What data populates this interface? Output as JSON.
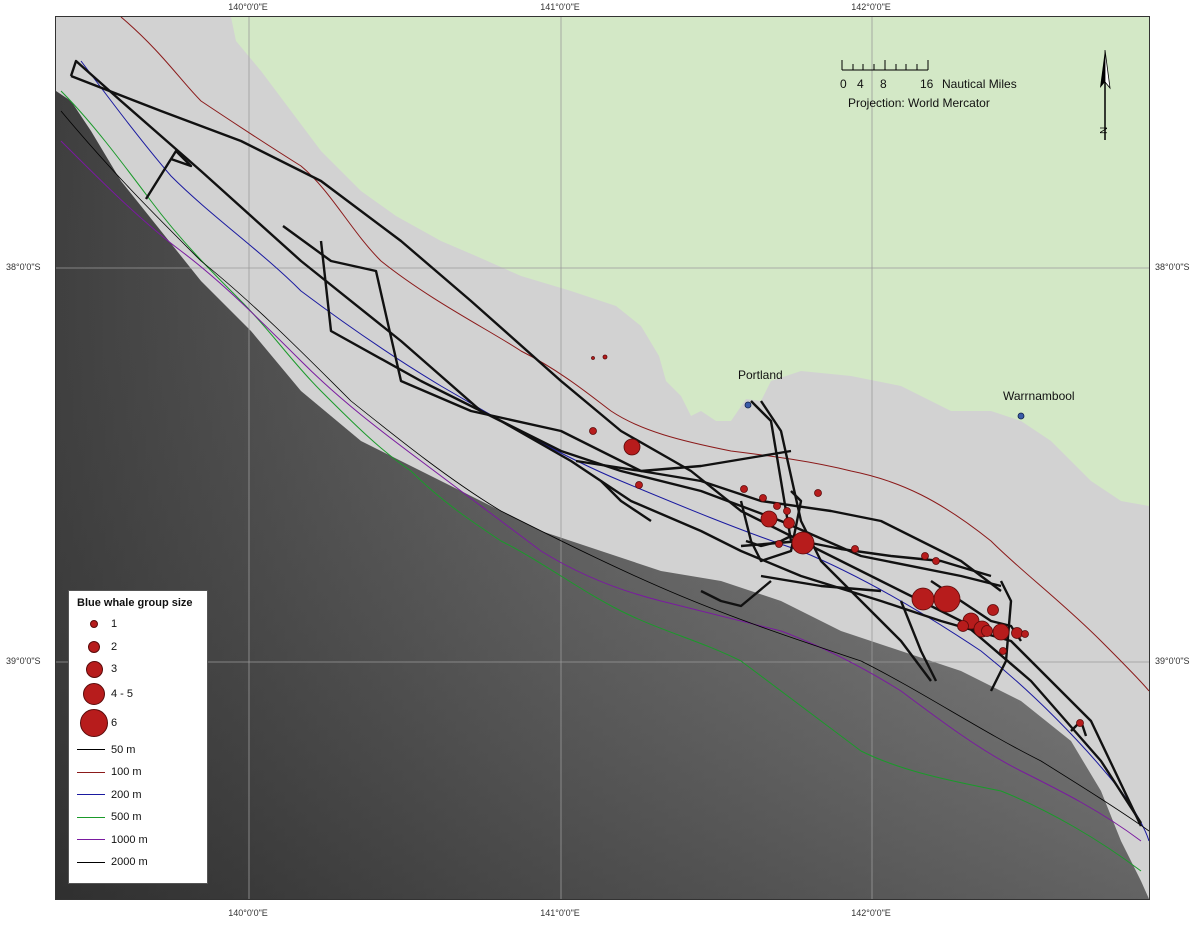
{
  "graticule": {
    "top": [
      "140°0'0\"E",
      "141°0'0\"E",
      "142°0'0\"E"
    ],
    "bottom": [
      "140°0'0\"E",
      "141°0'0\"E",
      "142°0'0\"E"
    ],
    "left": [
      "38°0'0\"S",
      "39°0'0\"S"
    ],
    "right": [
      "38°0'0\"S",
      "39°0'0\"S"
    ]
  },
  "scale_bar": {
    "ticks": [
      "0",
      "4",
      "8",
      "16"
    ],
    "unit": "Nautical Miles"
  },
  "projection": "Projection: World Mercator",
  "north_arrow": {
    "label": "N"
  },
  "towns": [
    {
      "name": "Portland"
    },
    {
      "name": "Warrnambool"
    }
  ],
  "legend": {
    "title": "Blue whale group size",
    "sizes": [
      {
        "label": "1"
      },
      {
        "label": "2"
      },
      {
        "label": "3"
      },
      {
        "label": "4 - 5"
      },
      {
        "label": "6"
      }
    ],
    "contours": [
      {
        "label": "50 m",
        "color": "#000000"
      },
      {
        "label": "100 m",
        "color": "#8b1a1a"
      },
      {
        "label": "200 m",
        "color": "#1a1aa0"
      },
      {
        "label": "500 m",
        "color": "#1a9a2a"
      },
      {
        "label": "1000 m",
        "color": "#7a1aa0"
      },
      {
        "label": "2000 m",
        "color": "#000000"
      }
    ]
  },
  "colors": {
    "land": "#d3e8c6",
    "shelf": "#d2d2d2",
    "sighting": "#b71c1c",
    "track": "#111111",
    "town": "#3b5ba8"
  }
}
